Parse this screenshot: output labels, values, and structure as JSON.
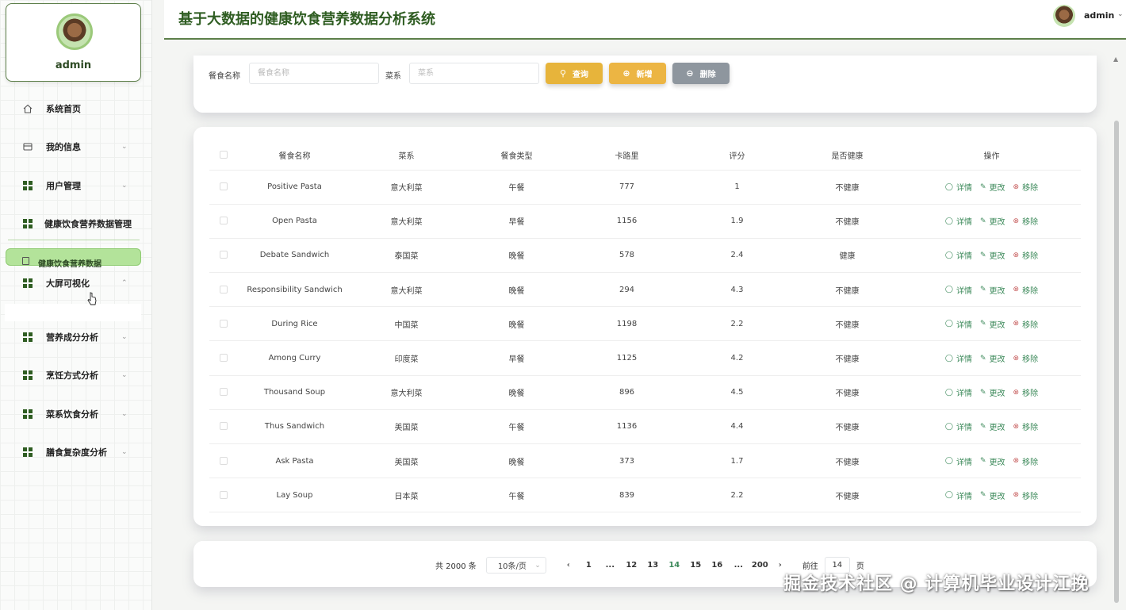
{
  "app": {
    "title": "基于大数据的健康饮食营养数据分析系统",
    "user": "admin"
  },
  "sidebar": {
    "profile_name": "admin",
    "items": [
      {
        "label": "系统首页",
        "icon": "home-icon"
      },
      {
        "label": "我的信息",
        "icon": "card-icon"
      },
      {
        "label": "用户管理",
        "icon": "grid-icon"
      },
      {
        "label": "健康饮食营养数据管理",
        "icon": "grid-icon"
      },
      {
        "label": "大屏可视化",
        "icon": "grid-icon"
      },
      {
        "label": "营养成分分析",
        "icon": "grid-icon"
      },
      {
        "label": "烹饪方式分析",
        "icon": "grid-icon"
      },
      {
        "label": "菜系饮食分析",
        "icon": "grid-icon"
      },
      {
        "label": "膳食复杂度分析",
        "icon": "grid-icon"
      }
    ],
    "active_sub": "健康饮食营养数据"
  },
  "search": {
    "name_label": "餐食名称",
    "name_placeholder": "餐食名称",
    "cuisine_label": "菜系",
    "cuisine_placeholder": "菜系",
    "query_label": "查询",
    "add_label": "新增",
    "delete_label": "删除"
  },
  "table": {
    "columns": [
      "餐食名称",
      "菜系",
      "餐食类型",
      "卡路里",
      "评分",
      "是否健康",
      "操作"
    ],
    "ops": {
      "detail": "详情",
      "edit": "更改",
      "remove": "移除"
    },
    "rows": [
      {
        "name": "Positive Pasta",
        "cuisine": "意大利菜",
        "type": "午餐",
        "calories": "777",
        "rating": "1",
        "healthy": "不健康"
      },
      {
        "name": "Open Pasta",
        "cuisine": "意大利菜",
        "type": "早餐",
        "calories": "1156",
        "rating": "1.9",
        "healthy": "不健康"
      },
      {
        "name": "Debate Sandwich",
        "cuisine": "泰国菜",
        "type": "晚餐",
        "calories": "578",
        "rating": "2.4",
        "healthy": "健康"
      },
      {
        "name": "Responsibility Sandwich",
        "cuisine": "意大利菜",
        "type": "晚餐",
        "calories": "294",
        "rating": "4.3",
        "healthy": "不健康"
      },
      {
        "name": "During Rice",
        "cuisine": "中国菜",
        "type": "晚餐",
        "calories": "1198",
        "rating": "2.2",
        "healthy": "不健康"
      },
      {
        "name": "Among Curry",
        "cuisine": "印度菜",
        "type": "早餐",
        "calories": "1125",
        "rating": "4.2",
        "healthy": "不健康"
      },
      {
        "name": "Thousand Soup",
        "cuisine": "意大利菜",
        "type": "晚餐",
        "calories": "896",
        "rating": "4.5",
        "healthy": "不健康"
      },
      {
        "name": "Thus Sandwich",
        "cuisine": "美国菜",
        "type": "午餐",
        "calories": "1136",
        "rating": "4.4",
        "healthy": "不健康"
      },
      {
        "name": "Ask Pasta",
        "cuisine": "美国菜",
        "type": "晚餐",
        "calories": "373",
        "rating": "1.7",
        "healthy": "不健康"
      },
      {
        "name": "Lay Soup",
        "cuisine": "日本菜",
        "type": "午餐",
        "calories": "839",
        "rating": "2.2",
        "healthy": "不健康"
      }
    ]
  },
  "pagination": {
    "total": "共 2000 条",
    "page_size": "10条/页",
    "pages": [
      "1",
      "...",
      "12",
      "13",
      "14",
      "15",
      "16",
      "...",
      "200"
    ],
    "current": "14",
    "goto_label": "前往",
    "goto_value": "14",
    "goto_suffix": "页"
  },
  "watermark": "掘金技术社区 @ 计算机毕业设计江挽",
  "colors": {
    "brand": "#2f5d22",
    "accent": "#3d8a5b",
    "query": "#e7b43b",
    "delete": "#8e969e",
    "active_menu": "#b3e39a"
  }
}
